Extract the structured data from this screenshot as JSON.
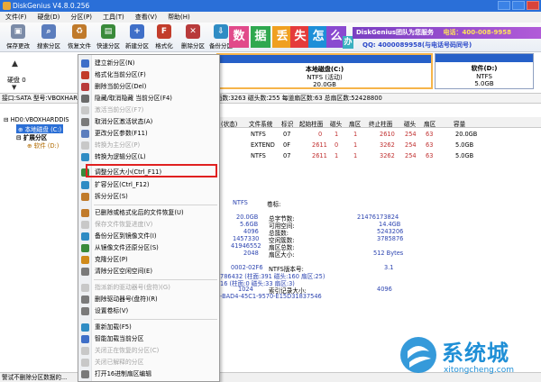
{
  "window": {
    "title": "DiskGenius V4.8.0.256"
  },
  "menubar": [
    "文件(F)",
    "硬盘(D)",
    "分区(P)",
    "工具(T)",
    "查看(V)",
    "帮助(H)"
  ],
  "toolbar": {
    "buttons": [
      {
        "label": "保存更改",
        "icon": "save-icon",
        "color": "#7b8ba7"
      },
      {
        "label": "搜索分区",
        "icon": "search-icon",
        "color": "#5b7dbd"
      },
      {
        "label": "恢复文件",
        "icon": "recover-icon",
        "color": "#c07a2a"
      },
      {
        "label": "快速分区",
        "icon": "quick-partition-icon",
        "color": "#3a8a3a"
      },
      {
        "label": "新建分区",
        "icon": "new-partition-icon",
        "color": "#3f6fc8"
      },
      {
        "label": "格式化",
        "icon": "format-icon",
        "color": "#c23c2a"
      },
      {
        "label": "删除分区",
        "icon": "delete-icon",
        "color": "#b83a3a"
      },
      {
        "label": "备份分区",
        "icon": "backup-icon",
        "color": "#2f8cc4"
      }
    ]
  },
  "banner": {
    "chars": [
      "数",
      "据",
      "丢",
      "失",
      "怎",
      "么",
      "办"
    ],
    "ribbon": "DiskGenius团队为您服务",
    "phone": "电话：400-008-9958",
    "qq": "QQ: 4000089958(与电话号码同号)"
  },
  "disk_map": {
    "disk_label": "硬盘 0",
    "partitions": [
      {
        "name": "本地磁盘(C:)",
        "fs": "NTFS (活动)",
        "size": "20.0GB"
      },
      {
        "name": "软件(D:)",
        "fs": "NTFS",
        "size": "5.0GB"
      }
    ]
  },
  "infoline": "接口:SATA  型号:VBOXHARDDISK  序列号:VB...  容量:25.0GB (25600MB)  柱面数:3263  磁头数:255  每道扇区数:63  总扇区数:52428800",
  "tree": {
    "items": [
      {
        "label": "HD0:VBOXHARDDIS"
      },
      {
        "label": "本地磁盘 (C:)"
      },
      {
        "label": "扩展分区"
      },
      {
        "label": "软件 (D:)"
      }
    ]
  },
  "partition_table": {
    "headers": [
      "(状态)",
      "文件系统",
      "标识",
      "起始柱面",
      "磁头",
      "扇区",
      "终止柱面",
      "磁头",
      "扇区",
      "容量"
    ],
    "rows": [
      [
        "",
        "NTFS",
        "07",
        "0",
        "1",
        "1",
        "2610",
        "254",
        "63",
        "20.0GB"
      ],
      [
        "",
        "EXTEND",
        "0F",
        "2611",
        "0",
        "1",
        "3262",
        "254",
        "63",
        "5.0GB"
      ],
      [
        "",
        "NTFS",
        "07",
        "2611",
        "1",
        "1",
        "3262",
        "254",
        "63",
        "5.0GB"
      ]
    ]
  },
  "details": {
    "fs_type": "NTFS",
    "volume_label_key": "卷标:",
    "left_values": [
      "20.0GB",
      "5.6GB",
      "4096",
      "1457330",
      "41946552",
      "2048"
    ],
    "mid_keys": [
      "总字节数:",
      "可用空间:",
      "总簇数:",
      "空闲簇数:",
      "扇区总数:",
      "扇区大小:"
    ],
    "right_values": [
      "21476173824",
      "14.4GB",
      "5243206",
      "3785876",
      "",
      "512 Bytes"
    ],
    "lower": [
      {
        "a": "0002-02F6",
        "b": "NTFS版本号:",
        "c": "3.1"
      },
      {
        "a": "786432 (柱面:391 磁头:160 扇区:25)",
        "b": "",
        "c": ""
      },
      {
        "a": "16 (柱面:0 磁头:33 扇区:3)",
        "b": "",
        "c": ""
      },
      {
        "a": "1024",
        "b": "索引记录大小:",
        "c": "4096"
      },
      {
        "a": "-BAD4-45C1-9570-E15D31837546",
        "b": "",
        "c": ""
      }
    ]
  },
  "context_menu": {
    "items": [
      {
        "label": "建立新分区(N)",
        "enabled": true,
        "icon": "new-partition-icon",
        "color": "#3f6fc8"
      },
      {
        "label": "格式化当前分区(F)",
        "enabled": true,
        "icon": "format-icon",
        "color": "#c23c2a"
      },
      {
        "label": "删除当前分区(Del)",
        "enabled": true,
        "icon": "delete-icon",
        "color": "#b83a3a"
      },
      {
        "label": "隐藏/取消隐藏 当前分区(F4)",
        "enabled": true,
        "icon": "hide-icon",
        "color": "#6a6a6a"
      },
      {
        "label": "激活当前分区(F7)",
        "enabled": false,
        "icon": "activate-icon",
        "color": "#c8c8c8"
      },
      {
        "label": "取消分区激活状态(A)",
        "enabled": true,
        "icon": "deactivate-icon",
        "color": "#7a7a7a"
      },
      {
        "label": "更改分区参数(F11)",
        "enabled": true,
        "icon": "params-icon",
        "color": "#5b7dbd"
      },
      {
        "label": "转换为主分区(P)",
        "enabled": false,
        "icon": "convert-primary-icon",
        "color": "#c8c8c8"
      },
      {
        "label": "转换为逻辑分区(L)",
        "enabled": true,
        "icon": "convert-logical-icon",
        "color": "#2f8cc4"
      },
      {
        "label": "调整分区大小(Ctrl_F11)",
        "enabled": true,
        "icon": "resize-icon",
        "color": "#3a8a3a"
      },
      {
        "label": "扩容分区(Ctrl_F12)",
        "enabled": true,
        "icon": "extend-icon",
        "color": "#2f8cc4"
      },
      {
        "label": "拆分分区(S)",
        "enabled": true,
        "icon": "split-icon",
        "color": "#c07a2a"
      },
      {
        "label": "已删除或格式化后的文件恢复(U)",
        "enabled": true,
        "icon": "recover-icon",
        "color": "#c07a2a"
      },
      {
        "label": "保存文件恢复进度(V)",
        "enabled": false,
        "icon": "save-progress-icon",
        "color": "#c8c8c8"
      },
      {
        "label": "备份分区到镜像文件(I)",
        "enabled": true,
        "icon": "backup-icon",
        "color": "#2f8cc4"
      },
      {
        "label": "从镜像文件还原分区(S)",
        "enabled": true,
        "icon": "restore-icon",
        "color": "#3a8a3a"
      },
      {
        "label": "克隆分区(P)",
        "enabled": true,
        "icon": "clone-icon",
        "color": "#d08a1a"
      },
      {
        "label": "清除分区空闲空间(E)",
        "enabled": true,
        "icon": "wipe-icon",
        "color": "#7a7a7a"
      },
      {
        "label": "指派新的驱动器号(盘符)(G)",
        "enabled": false,
        "icon": "assign-letter-icon",
        "color": "#c8c8c8"
      },
      {
        "label": "删除驱动器号(盘符)(R)",
        "enabled": true,
        "icon": "remove-letter-icon",
        "color": "#7a7a7a"
      },
      {
        "label": "设置卷标(V)",
        "enabled": true,
        "icon": "label-icon",
        "color": "#7a7a7a"
      },
      {
        "label": "重新加载(F5)",
        "enabled": true,
        "icon": "reload-icon",
        "color": "#2f8cc4"
      },
      {
        "label": "智能加载当前分区",
        "enabled": true,
        "icon": "smart-load-icon",
        "color": "#3f6fc8"
      },
      {
        "label": "关闭正在恢复的分区(C)",
        "enabled": false,
        "icon": "close-recover-icon",
        "color": "#c8c8c8"
      },
      {
        "label": "关闭已解释的分区",
        "enabled": false,
        "icon": "close-parsed-icon",
        "color": "#c8c8c8"
      },
      {
        "label": "打开16进制扇区编辑",
        "enabled": true,
        "icon": "hex-editor-icon",
        "color": "#7a7a7a"
      }
    ]
  },
  "status": "警试不删除分区数据的...",
  "watermark": {
    "brand": "系统城",
    "url": "xitongcheng.com",
    "accent": "#1f8fd6"
  }
}
